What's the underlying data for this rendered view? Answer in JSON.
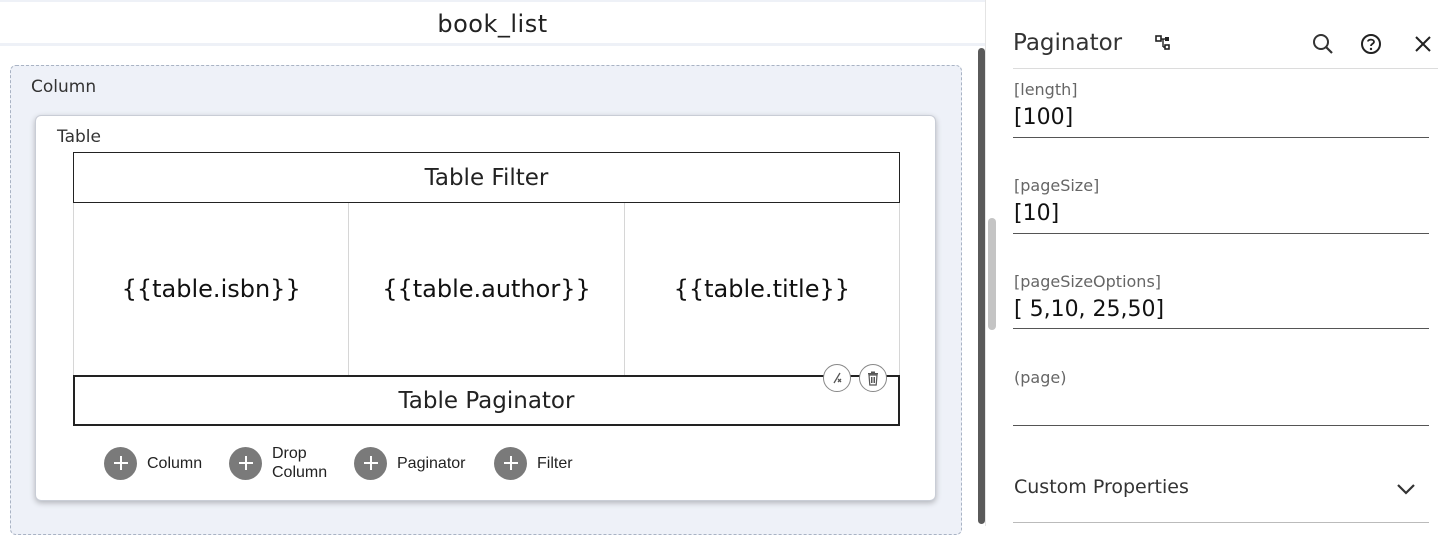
{
  "page": {
    "title": "book_list"
  },
  "canvas": {
    "column_label": "Column",
    "table_label": "Table",
    "filter_label": "Table Filter",
    "columns": [
      "{{table.isbn}}",
      "{{table.author}}",
      "{{table.title}}"
    ],
    "paginator_label": "Table Paginator",
    "add_buttons": [
      {
        "label": "Column"
      },
      {
        "label": "Drop\nColumn"
      },
      {
        "label": "Paginator"
      },
      {
        "label": "Filter"
      }
    ]
  },
  "panel": {
    "title": "Paginator",
    "properties": [
      {
        "label": "[length]",
        "value": "[100]"
      },
      {
        "label": "[pageSize]",
        "value": "[10]"
      },
      {
        "label": "[pageSizeOptions]",
        "value": "[ 5,10, 25,50]"
      },
      {
        "label": "(page)",
        "value": ""
      }
    ],
    "custom_properties_label": "Custom Properties"
  },
  "colors": {
    "canvas_bg": "#eef1f8",
    "add_button": "#7a7a7a",
    "scroll_thumb": "#5a5a5a"
  }
}
